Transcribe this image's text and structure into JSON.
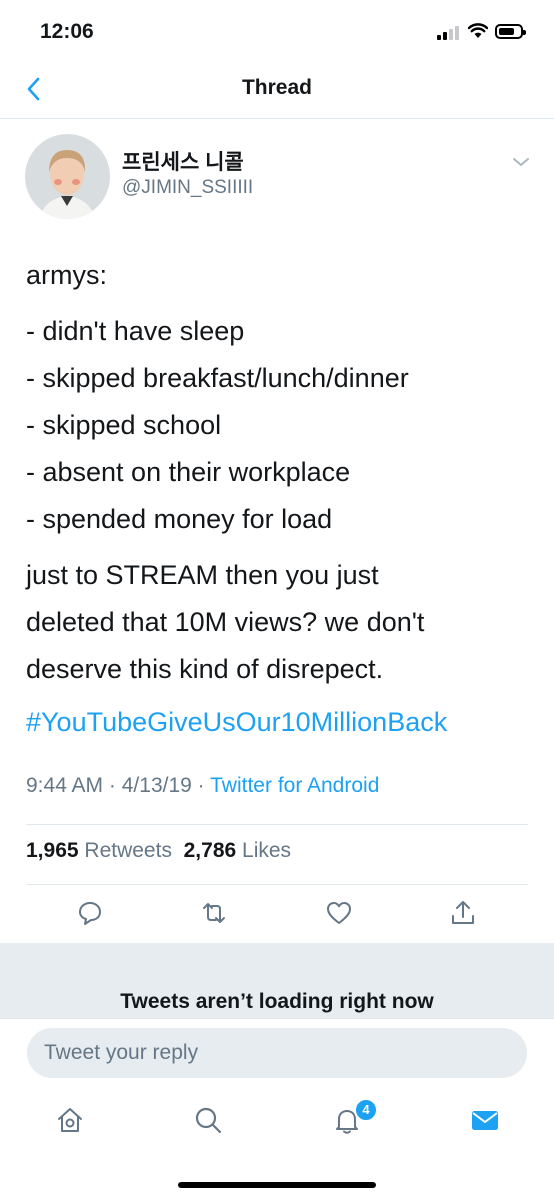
{
  "status_bar": {
    "time": "12:06",
    "battery_level": 0.75,
    "icons": [
      "cellular-signal-icon",
      "wifi-icon",
      "battery-icon"
    ]
  },
  "header": {
    "title": "Thread",
    "back_icon": "chevron-left-icon"
  },
  "tweet": {
    "display_name": "프린세스 니콜",
    "username": "@JIMIN_SSIIIII",
    "lines": [
      "armys:",
      "- didn't have sleep",
      "- skipped breakfast/lunch/dinner",
      "- skipped school",
      "- absent on their workplace",
      "- spended money for load",
      "just to STREAM then you just",
      "deleted that 10M views? we don't",
      "deserve this kind of disrepect."
    ],
    "hashtag": "#YouTubeGiveUsOur10MillionBack",
    "time": "9:44 AM",
    "separator": "·",
    "date": "4/13/19",
    "source": "Twitter for Android",
    "retweets_count": "1,965",
    "retweets_label": "Retweets",
    "likes_count": "2,786",
    "likes_label": "Likes"
  },
  "actions": [
    "reply-icon",
    "retweet-icon",
    "like-icon",
    "share-icon"
  ],
  "loading_message": "Tweets aren’t loading right now",
  "reply": {
    "placeholder": "Tweet your reply"
  },
  "tab_bar": {
    "tabs": [
      "home-icon",
      "search-icon",
      "notifications-icon",
      "messages-icon"
    ],
    "notifications_badge": "4"
  },
  "colors": {
    "accent": "#1da1f2",
    "secondary_text": "#657786",
    "divider": "#e1e8ed",
    "background_gray": "#e6ecf0"
  }
}
